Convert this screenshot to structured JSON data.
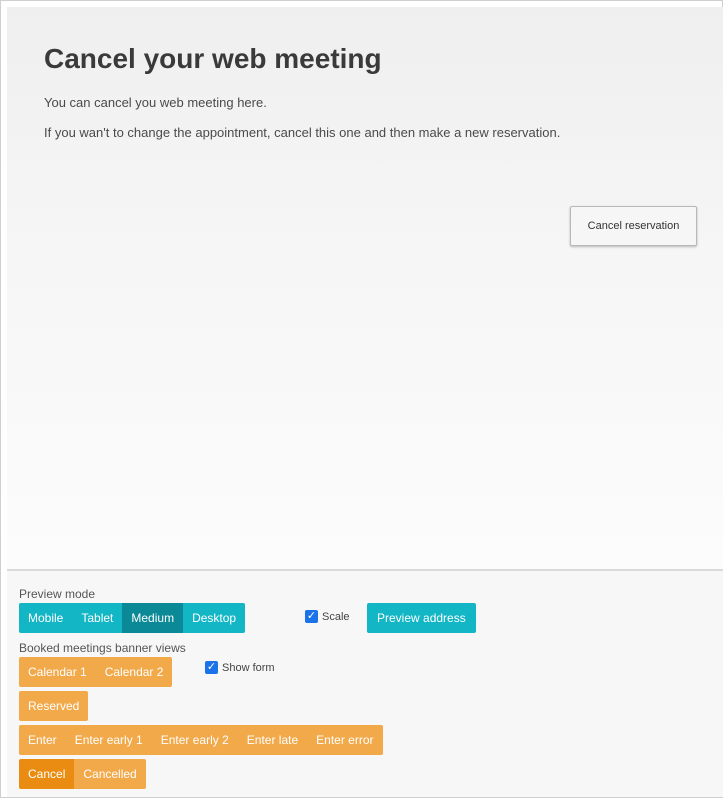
{
  "preview": {
    "title": "Cancel your web meeting",
    "paragraph1": "You can cancel you web meeting here.",
    "paragraph2": "If you wan't to change the appointment, cancel this one and then make a new reservation.",
    "cancel_button": "Cancel reservation"
  },
  "controls": {
    "preview_mode_label": "Preview mode",
    "modes": [
      "Mobile",
      "Tablet",
      "Medium",
      "Desktop"
    ],
    "active_mode": "Medium",
    "scale_label": "Scale",
    "scale_checked": true,
    "preview_address": "Preview address",
    "banner_views_label": "Booked meetings banner views",
    "calendar_views": [
      "Calendar 1",
      "Calendar 2"
    ],
    "show_form_label": "Show form",
    "show_form_checked": true,
    "reserved": "Reserved",
    "enter_views": [
      "Enter",
      "Enter early 1",
      "Enter early 2",
      "Enter late",
      "Enter error"
    ],
    "cancel_views": [
      "Cancel",
      "Cancelled"
    ],
    "active_cancel_view": "Cancel"
  },
  "colors": {
    "teal": "#12b6c5",
    "teal_active": "#0b8996",
    "orange": "#f2a94a",
    "orange_active": "#ea8c12",
    "checkbox": "#1a73e8"
  }
}
